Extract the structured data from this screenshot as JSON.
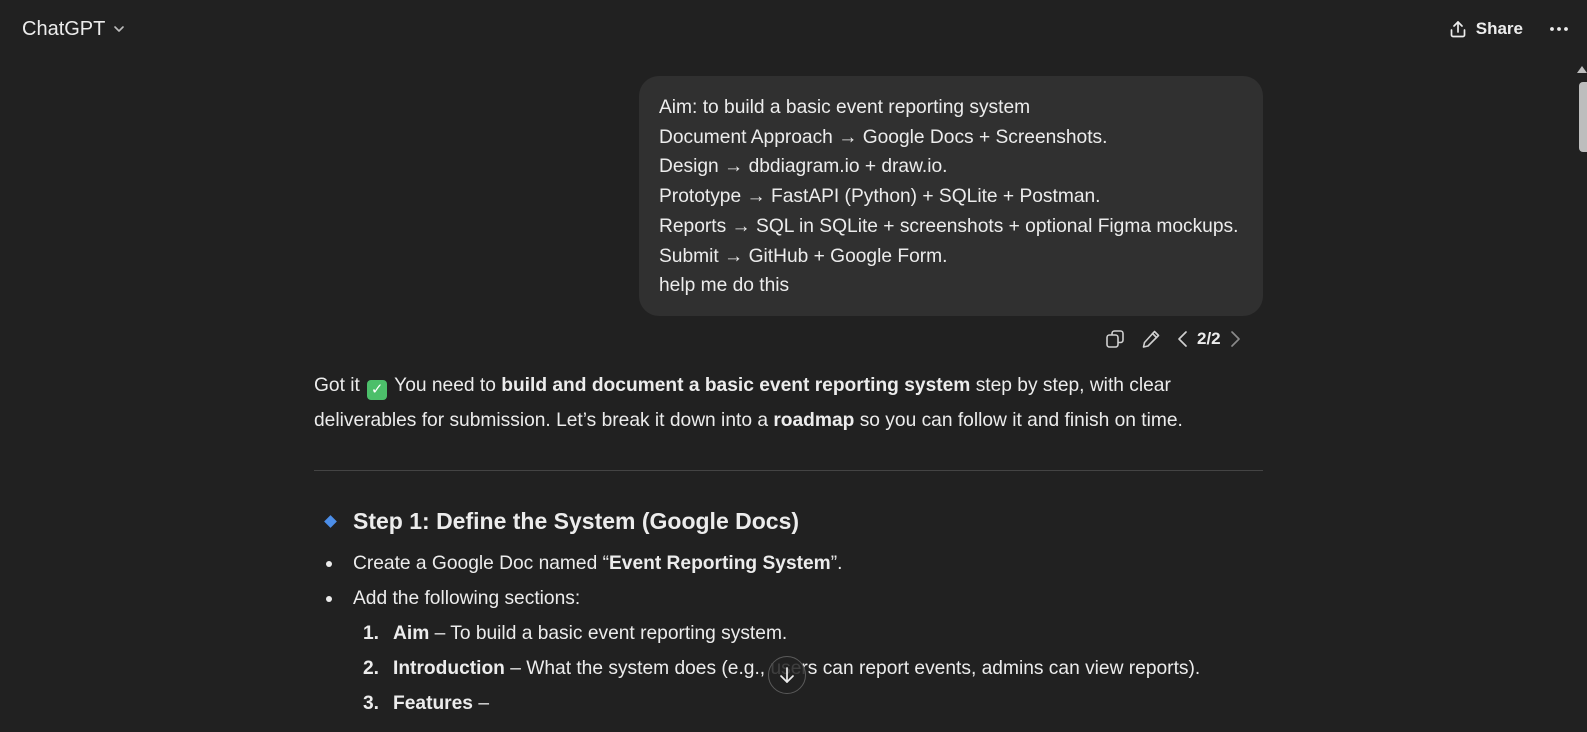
{
  "header": {
    "model_name": "ChatGPT",
    "share_label": "Share"
  },
  "user_message": {
    "lines": [
      "Aim: to build a basic event reporting system",
      "Document Approach → Google Docs + Screenshots.",
      "Design → dbdiagram.io + draw.io.",
      "Prototype → FastAPI (Python) + SQLite + Postman.",
      "Reports → SQL in SQLite + screenshots + optional Figma mockups.",
      "Submit → GitHub + Google Form.",
      "help me do this"
    ],
    "pager": "2/2"
  },
  "assistant": {
    "intro": {
      "p1": "Got it ",
      "p2": " You need to ",
      "b1": "build and document a basic event reporting system",
      "p3": " step by step, with clear deliverables for submission. Let’s break it down into a ",
      "b2": "roadmap",
      "p4": " so you can follow it and finish on time."
    },
    "step1": {
      "heading": "Step 1: Define the System (Google Docs)",
      "bullet1": {
        "pre": "Create a Google Doc named “",
        "bold": "Event Reporting System",
        "post": "”."
      },
      "bullet2": "Add the following sections:",
      "numbered": [
        {
          "num": "1.",
          "bold": "Aim",
          "text": " – To build a basic event reporting system."
        },
        {
          "num": "2.",
          "bold": "Introduction",
          "text": " – What the system does (e.g., users can report events, admins can view reports)."
        },
        {
          "num": "3.",
          "bold": "Features",
          "text": " –"
        }
      ]
    }
  },
  "icons": {
    "copy": "copy-icon",
    "edit": "pencil-icon",
    "prev": "chevron-left-icon",
    "next": "chevron-right-icon",
    "share": "upload-icon",
    "more": "ellipsis-icon",
    "scroll_down": "arrow-down-icon",
    "check": "check-mark-emoji"
  },
  "colors": {
    "background": "#212121",
    "bubble": "#303030",
    "diamond": "#4c8ee8",
    "check": "#4cbf6a"
  }
}
